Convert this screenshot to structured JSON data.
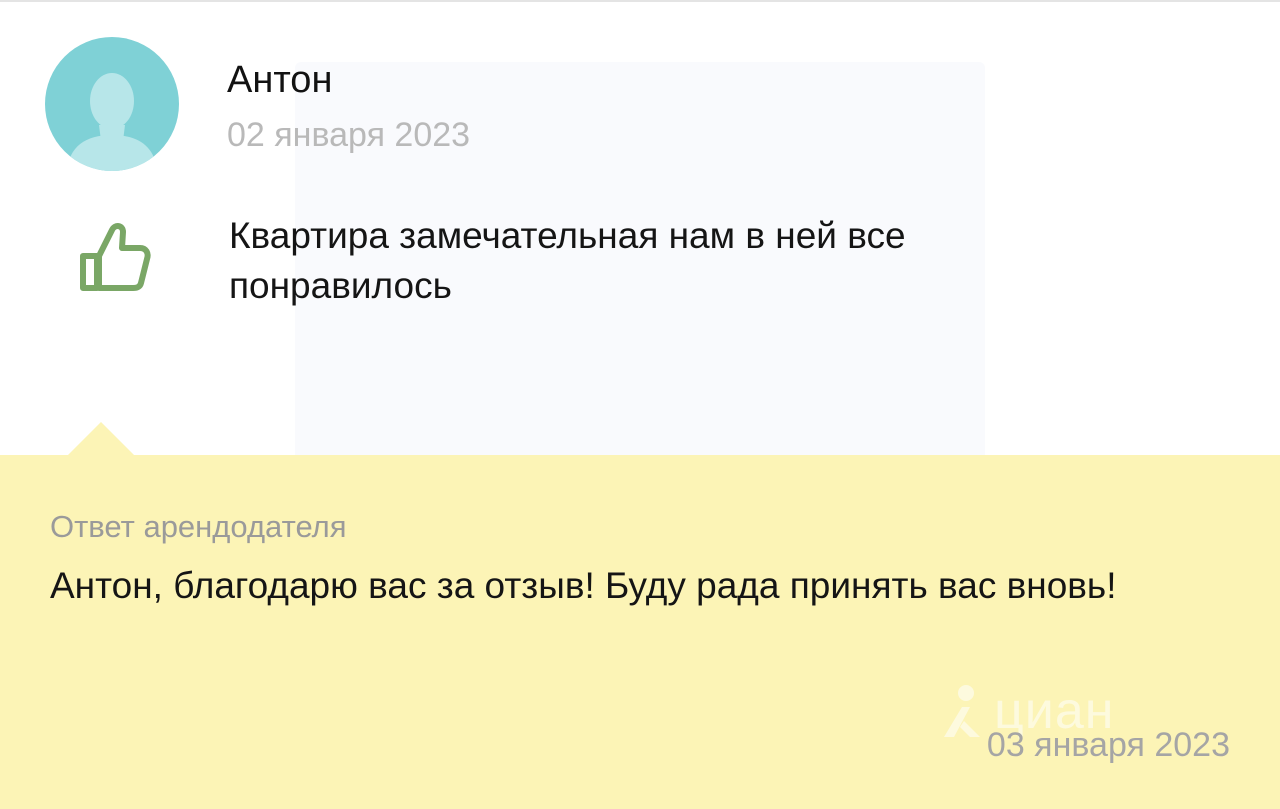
{
  "review": {
    "author": "Антон",
    "date": "02 января 2023",
    "text": "Квартира замечательная нам в ней все понравилось",
    "rating_icon": "thumbs-up-icon",
    "avatar_icon": "user-silhouette-icon"
  },
  "reply": {
    "heading": "Ответ арендодателя",
    "text": "Антон, благодарю вас за отзыв! Буду рада принять вас вновь!",
    "date": "03 января 2023"
  },
  "watermark": {
    "logo_text": "циан",
    "logo_icon": "cian-logo-icon"
  },
  "colors": {
    "avatar_bg": "#7fd1d6",
    "thumb": "#7aa766",
    "reply_bg": "#fcf4b6",
    "muted_text": "#b9b9b9"
  }
}
